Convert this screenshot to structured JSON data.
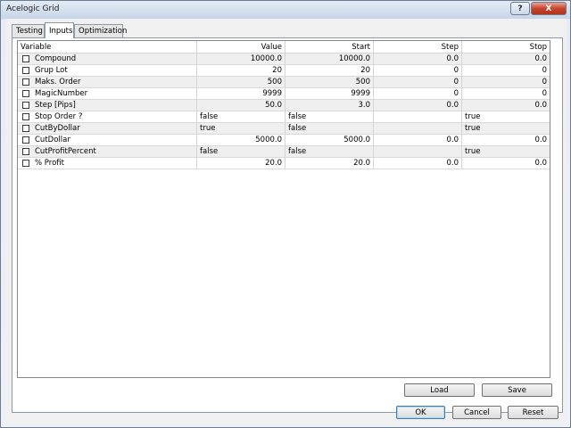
{
  "window": {
    "title": "Acelogic Grid"
  },
  "tabs": [
    {
      "label": "Testing"
    },
    {
      "label": "Inputs"
    },
    {
      "label": "Optimization"
    }
  ],
  "grid": {
    "columns": [
      "Variable",
      "Value",
      "Start",
      "Step",
      "Stop"
    ],
    "rows": [
      {
        "variable": "Compound",
        "value": "10000.0",
        "start": "10000.0",
        "step": "0.0",
        "stop": "0.0"
      },
      {
        "variable": "Grup Lot",
        "value": "20",
        "start": "20",
        "step": "0",
        "stop": "0"
      },
      {
        "variable": "Maks. Order",
        "value": "500",
        "start": "500",
        "step": "0",
        "stop": "0"
      },
      {
        "variable": "MagicNumber",
        "value": "9999",
        "start": "9999",
        "step": "0",
        "stop": "0"
      },
      {
        "variable": "Step [Pips]",
        "value": "50.0",
        "start": "3.0",
        "step": "0.0",
        "stop": "0.0"
      },
      {
        "variable": "Stop Order ?",
        "value": "false",
        "start": "false",
        "step": "",
        "stop": "true"
      },
      {
        "variable": "CutByDollar",
        "value": "true",
        "start": "false",
        "step": "",
        "stop": "true"
      },
      {
        "variable": "CutDollar",
        "value": "5000.0",
        "start": "5000.0",
        "step": "0.0",
        "stop": "0.0"
      },
      {
        "variable": "CutProfitPercent",
        "value": "false",
        "start": "false",
        "step": "",
        "stop": "true"
      },
      {
        "variable": "% Profit",
        "value": "20.0",
        "start": "20.0",
        "step": "0.0",
        "stop": "0.0"
      }
    ]
  },
  "buttons": {
    "load": "Load",
    "save": "Save",
    "ok": "OK",
    "cancel": "Cancel",
    "reset": "Reset"
  },
  "titlebar_buttons": {
    "help": "?",
    "close": "X"
  },
  "colors": {
    "close": "#c8452e",
    "row_alt": "#efefef"
  }
}
